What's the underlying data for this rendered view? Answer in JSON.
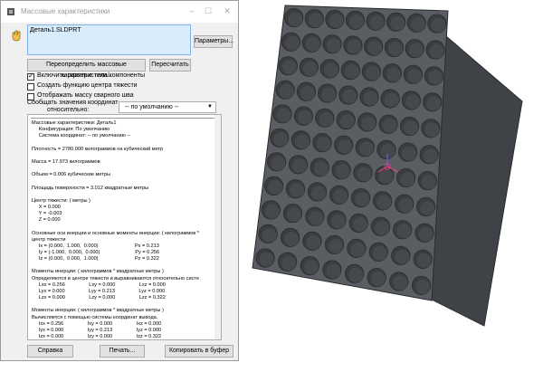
{
  "window": {
    "title": "Массовые характеристики",
    "minimize_icon": "minimize-icon",
    "maximize_icon": "maximize-icon",
    "close_icon": "close-icon"
  },
  "selection": {
    "file": "Деталь1.SLDPRT"
  },
  "buttons": {
    "parameters": "Параметры...",
    "override": "Переопределить массовые характеристики...",
    "recalculate": "Пересчитать",
    "help": "Справка",
    "print": "Печать...",
    "copy": "Копировать в буфер"
  },
  "options": [
    {
      "label": "Включить скрытые тела/компоненты",
      "checked": true
    },
    {
      "label": "Создать функцию центра тяжести",
      "checked": false
    },
    {
      "label": "Отображать массу сварного шва",
      "checked": false
    }
  ],
  "coord": {
    "label_line1": "Сообщать значения координат",
    "label_line2": "относительно:",
    "selected": "-- по умолчанию --"
  },
  "results": [
    "Массовые характеристики: Деталь1",
    "     Конфигурация: По умолчанию",
    "     Система координат: -- по умолчанию --",
    "",
    "Плотность = 2780.000 килограммов на кубический метр",
    "",
    "Масса = 17.973 килограммов",
    "",
    "Объем = 0.006 кубические метры",
    "",
    "Площадь поверхности = 3.012 квадратные метры",
    "",
    "Центр тяжести: ( метры )",
    "     X = 0.000",
    "     Y = -0.003",
    "     Z = 0.000",
    "",
    "Основные оси инерции и основные моменты инерции: ( килограммов *",
    "центр тяжести",
    "     Ix = (0.000,  1.000,  0.000)                          Px = 0.213",
    "     Iy = (-1.000,  0.000,  0.000)                         Py = 0.256",
    "     Iz = (0.000,  0.000,  1.000)                          Pz = 0.322",
    "",
    "Моменты инерции: ( килограммов * квадратные метры )",
    "Определяются в центре тяжести и выравниваются относительно систе",
    "     Lxx = 0.256                 Lxy = 0.000                 Lxz = 0.000",
    "     Lyx = 0.000                 Lyy = 0.213                 Lyz = 0.000",
    "     Lzx = 0.000                 Lzy = 0.000                 Lzz = 0.322",
    "",
    "Моменты инерции: ( килограммов * квадратные метры )",
    "Вычисляется с помощью системы координат вывода.",
    "     Ixx = 0.256                 Ixy = 0.000                 Ixz = 0.000",
    "     Iyx = 0.000                 Iyy = 0.213                 Iyz = 0.000",
    "     Izx = 0.000                 Izy = 0.000                 Izz = 0.322"
  ],
  "colors": {
    "model_face": "#5a5d62",
    "model_side": "#4a4d52",
    "hole": "#3a3c40",
    "selection_box": "#d9ecfb",
    "triad_x": "#e0407f",
    "triad_y": "#7a5ad6"
  }
}
